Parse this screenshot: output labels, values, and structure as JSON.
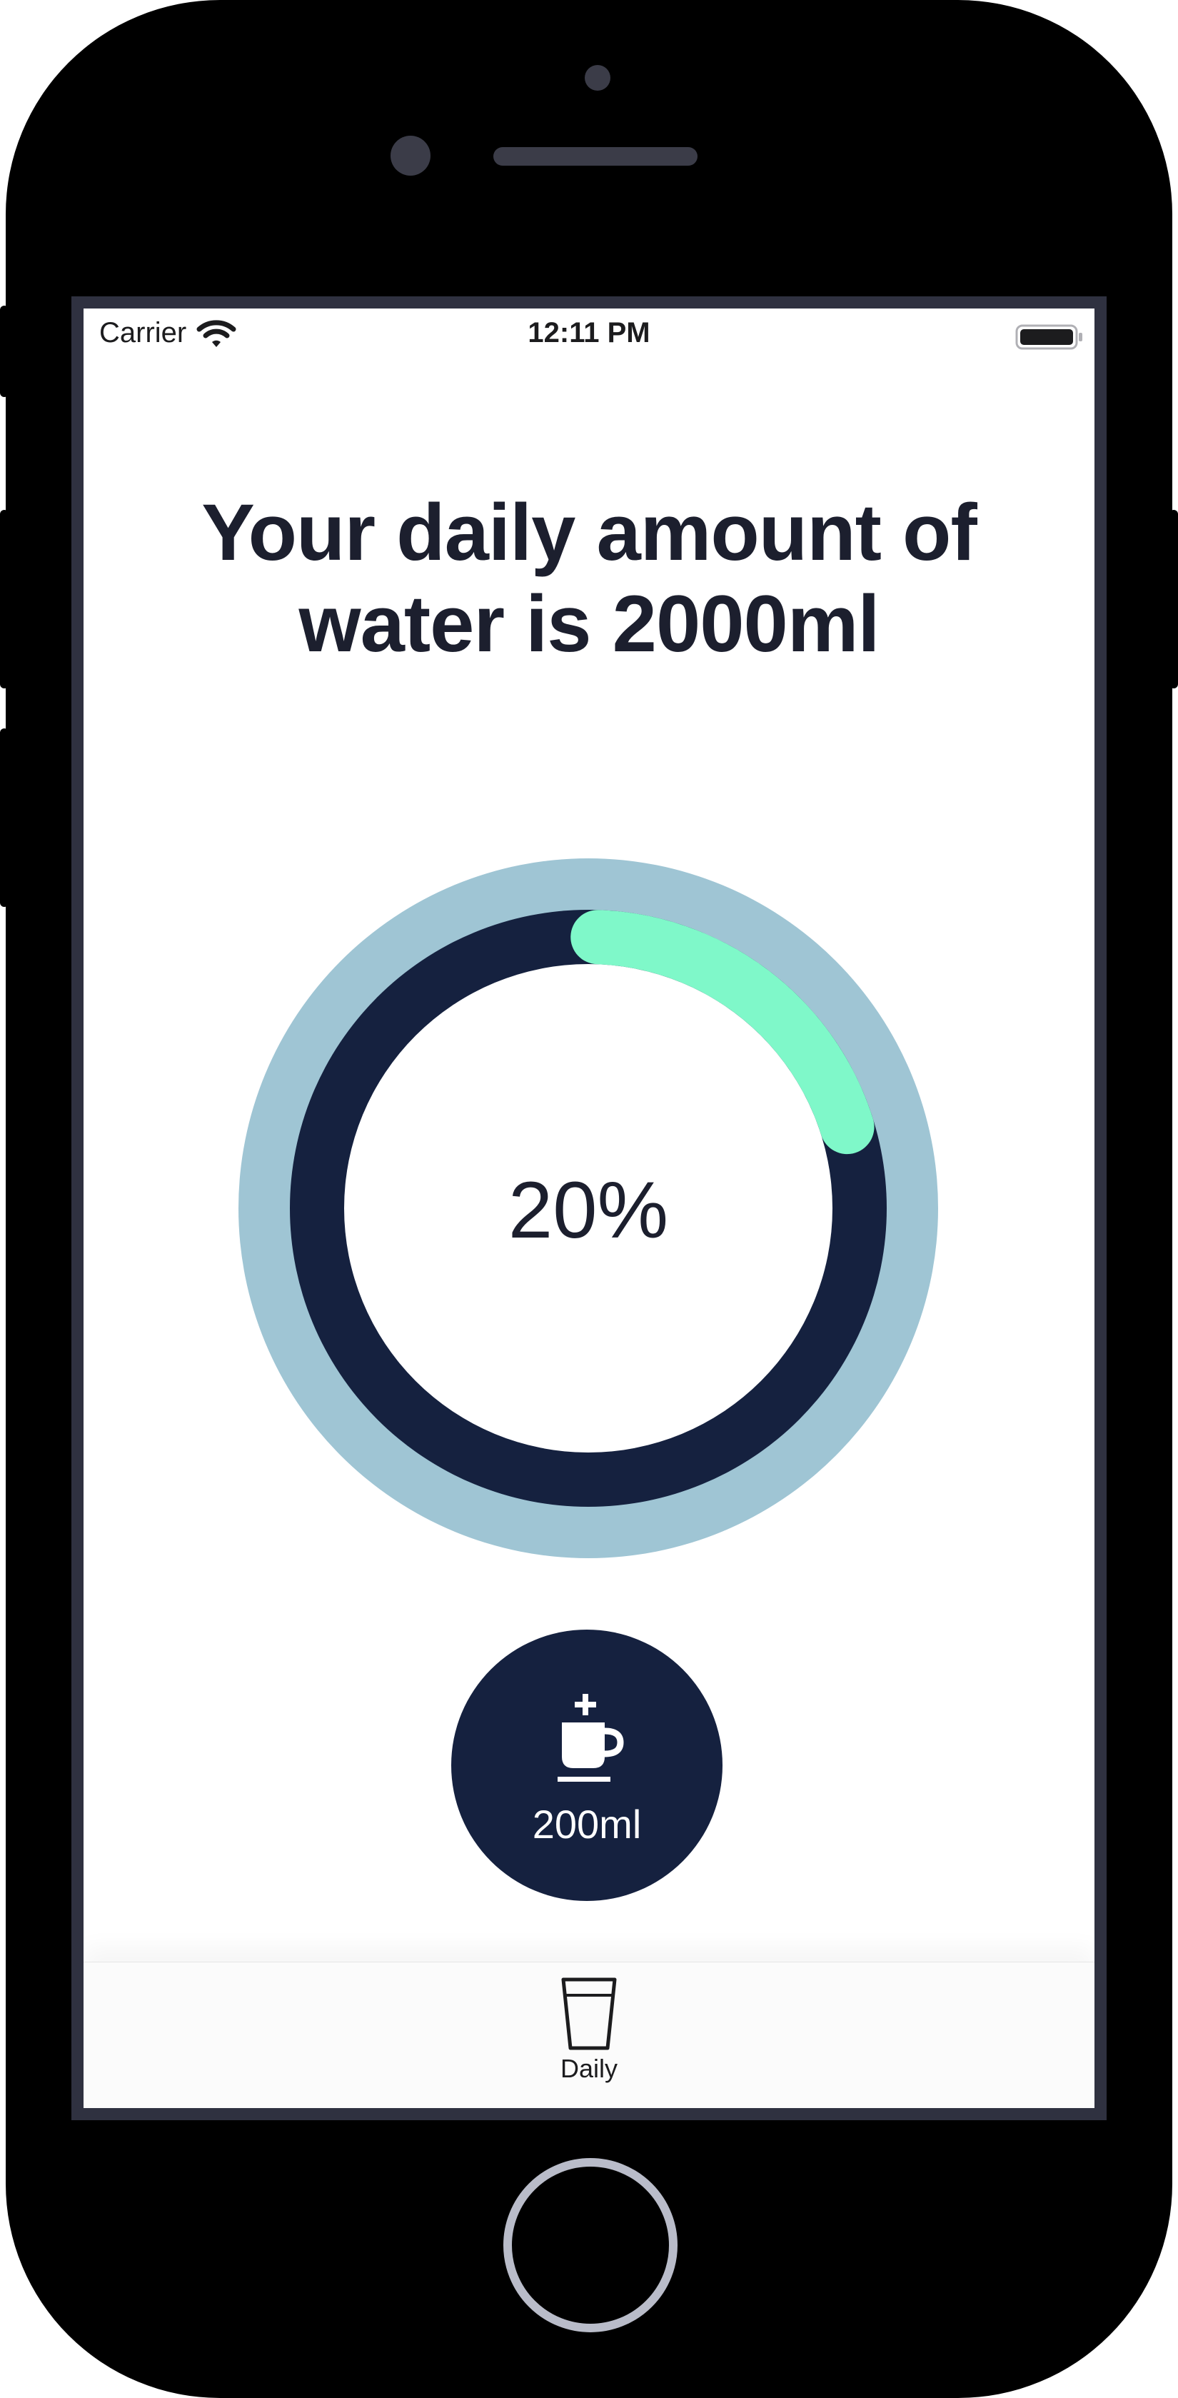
{
  "status_bar": {
    "carrier": "Carrier",
    "time": "12:11 PM",
    "wifi_icon": "wifi-icon",
    "battery_icon": "battery-icon"
  },
  "headline": "Your daily amount of water is 2000ml",
  "progress": {
    "percent_label": "20%",
    "fraction": 0.2,
    "colors": {
      "outer_ring": "#9fc5d4",
      "track": "#15213f",
      "fill": "#7ff8c9",
      "center": "#ffffff"
    }
  },
  "add_button": {
    "label": "200ml",
    "icon": "cup-plus-icon",
    "color": "#15213f"
  },
  "tab_bar": {
    "tabs": [
      {
        "label": "Daily",
        "icon": "glass-icon"
      }
    ]
  }
}
